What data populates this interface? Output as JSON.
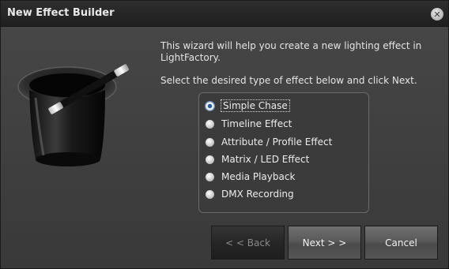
{
  "window": {
    "title": "New Effect Builder",
    "close_glyph": "✕"
  },
  "intro_text": "This wizard will help you create a new lighting effect in LightFactory.",
  "instruction_text": "Select the desired type of effect below and click Next.",
  "effect_types": {
    "selected_index": 0,
    "options": [
      {
        "label": "Simple Chase",
        "checked": true
      },
      {
        "label": "Timeline Effect",
        "checked": false
      },
      {
        "label": "Attribute / Profile Effect",
        "checked": false
      },
      {
        "label": "Matrix / LED Effect",
        "checked": false
      },
      {
        "label": "Media Playback",
        "checked": false
      },
      {
        "label": "DMX Recording",
        "checked": false
      }
    ]
  },
  "buttons": {
    "back": {
      "label": "< < Back",
      "enabled": false
    },
    "next": {
      "label": "Next > >",
      "enabled": true
    },
    "cancel": {
      "label": "Cancel",
      "enabled": true
    }
  },
  "icons": {
    "header_art": "magic-hat-wand-icon",
    "close": "close-icon",
    "radio": "radio-button-icon"
  },
  "colors": {
    "dialog_bg": "#3d3d3d",
    "titlebar_bg": "#1f1f1f",
    "text": "#e4e4e4",
    "radio_selected": "#1c5fa8"
  }
}
